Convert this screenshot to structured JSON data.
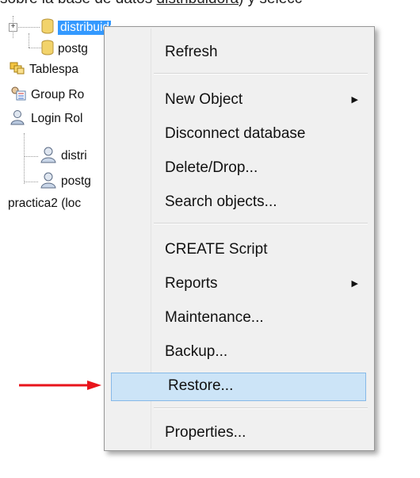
{
  "caption": {
    "prefix": "sobre la base de datos ",
    "link": "distribuidora",
    "suffix": ") y selecc"
  },
  "tree": {
    "items": [
      {
        "label": "distribuidora",
        "icon": "database-icon"
      },
      {
        "label": "postg",
        "icon": "database-icon"
      },
      {
        "label": "Tablespa",
        "icon": "tablespaces-icon"
      },
      {
        "label": "Group Ro",
        "icon": "group-roles-icon"
      },
      {
        "label": "Login Rol",
        "icon": "login-roles-icon"
      },
      {
        "label": "distri",
        "icon": "user-icon"
      },
      {
        "label": "postg",
        "icon": "user-icon"
      },
      {
        "label": "practica2 (loc",
        "icon": ""
      }
    ]
  },
  "menu": {
    "items": [
      {
        "label": "Refresh"
      },
      {
        "label": "New Object",
        "submenu": true
      },
      {
        "label": "Disconnect database"
      },
      {
        "label": "Delete/Drop..."
      },
      {
        "label": "Search objects..."
      },
      {
        "label": "CREATE Script"
      },
      {
        "label": "Reports",
        "submenu": true
      },
      {
        "label": "Maintenance..."
      },
      {
        "label": "Backup..."
      },
      {
        "label": "Restore...",
        "highlighted": true
      },
      {
        "label": "Properties..."
      }
    ],
    "submenu_arrow": "▶"
  },
  "colors": {
    "selection": "#3399ff",
    "menu_hover": "#cce4f7",
    "arrow": "#e8141b"
  }
}
